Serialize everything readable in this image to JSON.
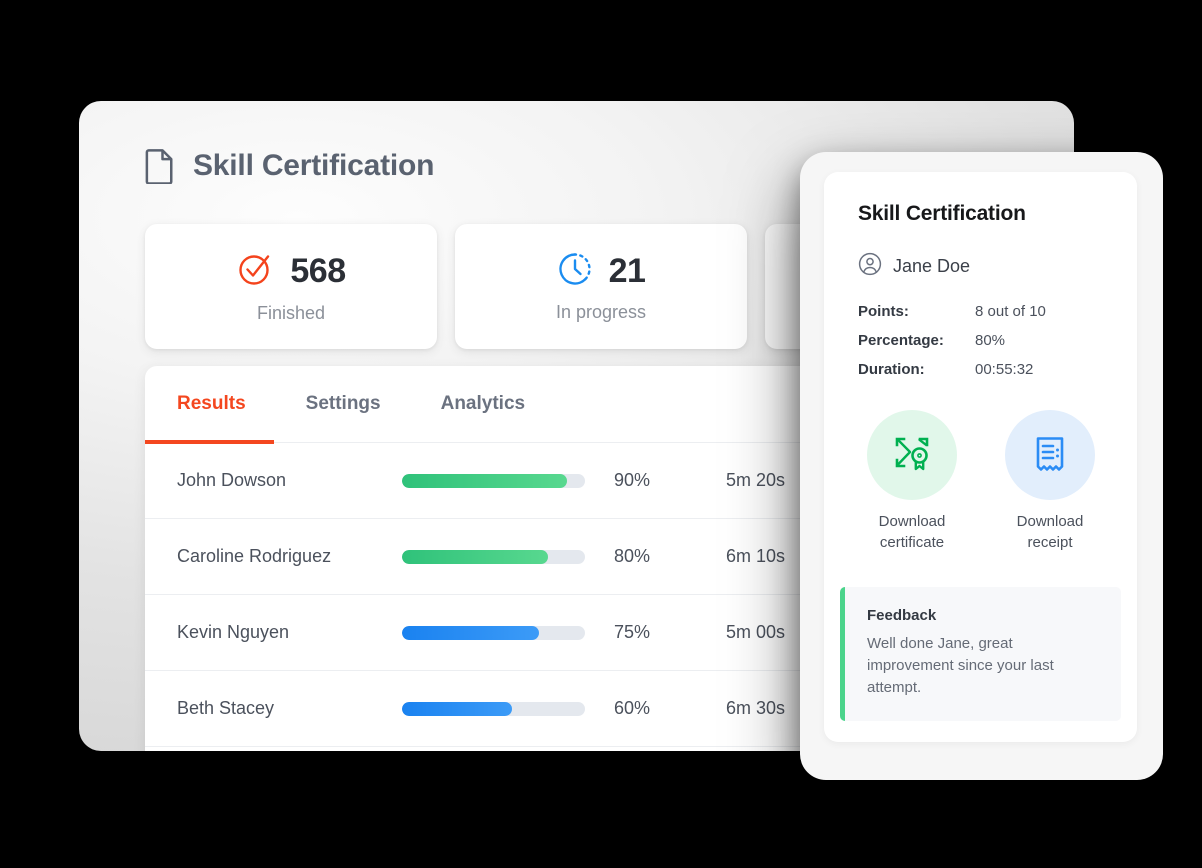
{
  "dashboard": {
    "title": "Skill Certification",
    "doc_icon": "document-icon",
    "stats": [
      {
        "icon": "check-circle-icon",
        "value": "568",
        "label": "Finished",
        "color": "#f4431c"
      },
      {
        "icon": "clock-icon",
        "value": "21",
        "label": "In progress",
        "color": "#1a8cf0"
      },
      {
        "icon": "",
        "value": "",
        "label": "",
        "color": ""
      }
    ],
    "tabs": [
      {
        "label": "Results",
        "active": true
      },
      {
        "label": "Settings",
        "active": false
      },
      {
        "label": "Analytics",
        "active": false
      }
    ],
    "table": {
      "rows": [
        {
          "name": "John Dowson",
          "percent": "90%",
          "percent_value": 90,
          "time": "5m 20s",
          "bar_color": "green"
        },
        {
          "name": "Caroline Rodriguez",
          "percent": "80%",
          "percent_value": 80,
          "time": "6m 10s",
          "bar_color": "green"
        },
        {
          "name": "Kevin Nguyen",
          "percent": "75%",
          "percent_value": 75,
          "time": "5m 00s",
          "bar_color": "blue"
        },
        {
          "name": "Beth Stacey",
          "percent": "60%",
          "percent_value": 60,
          "time": "6m 30s",
          "bar_color": "blue"
        }
      ]
    }
  },
  "detail": {
    "title": "Skill Certification",
    "user_icon": "user-circle-icon",
    "user_name": "Jane Doe",
    "meta": [
      {
        "key": "Points:",
        "value": "8 out of 10"
      },
      {
        "key": "Percentage:",
        "value": "80%"
      },
      {
        "key": "Duration:",
        "value": "00:55:32"
      }
    ],
    "actions": [
      {
        "icon": "certificate-icon",
        "label": "Download certificate",
        "color": "#00b050",
        "bg": "#e1f7ea"
      },
      {
        "icon": "receipt-icon",
        "label": "Download receipt",
        "color": "#2b8cf5",
        "bg": "#e2eefc"
      }
    ],
    "feedback": {
      "title": "Feedback",
      "text": "Well done Jane, great improvement since your last attempt.",
      "accent": "#4bd48b"
    }
  }
}
